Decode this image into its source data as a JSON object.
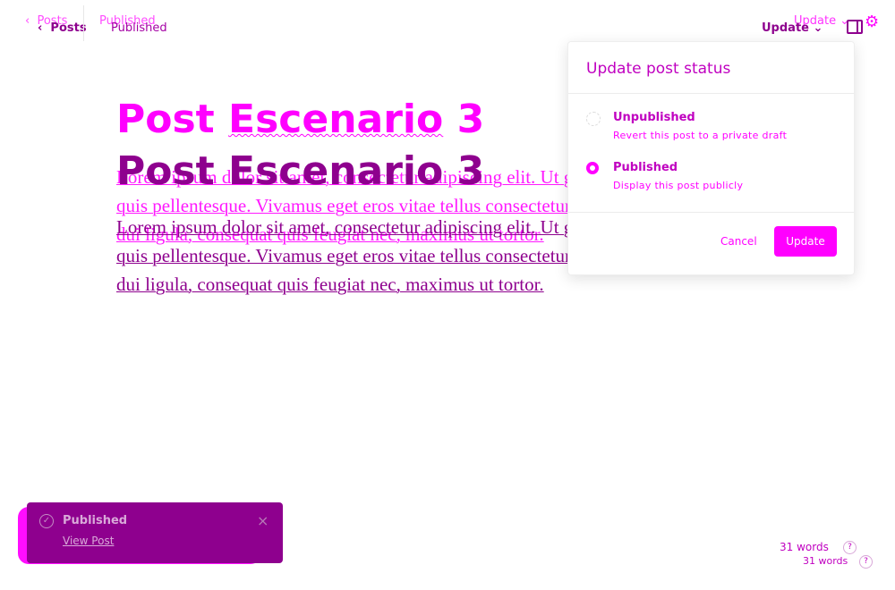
{
  "header": {
    "back_label": "Posts",
    "back_chevron": "‹",
    "status": "Published",
    "update_label": "Update",
    "update_chevron": "⌄",
    "icons": {
      "sidebar": "sidebar-toggle-icon",
      "settings": "gear-icon"
    }
  },
  "editor": {
    "title_word1": "Post",
    "title_word2": "Escenario",
    "title_word3": "3",
    "body": "Lorem ipsum dolor sit amet, consectetur adipiscing elit. Ut gravida scelerisque ex quis pellentesque. Vivamus eget eros vitae tellus consectetur porttitor. Pellentesque dui ligula, consequat quis feugiat nec, maximus ut tortor."
  },
  "popover": {
    "title": "Update post status",
    "options": [
      {
        "label": "Unpublished",
        "description": "Revert this post to a private draft",
        "selected": false
      },
      {
        "label": "Published",
        "description": "Display this post publicly",
        "selected": true
      }
    ],
    "cancel_label": "Cancel",
    "update_label": "Update"
  },
  "toast": {
    "title": "Published",
    "link": "View Post",
    "close": "×",
    "check": "✓"
  },
  "footer": {
    "word_count": "31 words",
    "help": "?"
  },
  "colors": {
    "accent": "#ff00ff",
    "primary": "#8e008e"
  }
}
